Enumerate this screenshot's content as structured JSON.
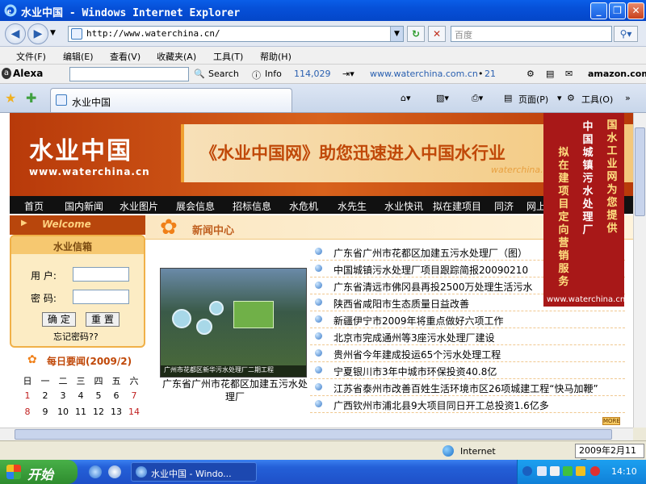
{
  "window": {
    "title": "水业中国 - Windows Internet Explorer"
  },
  "address": {
    "url": "http://www.waterchina.cn/",
    "search_placeholder": "百度"
  },
  "menu": [
    "文件(F)",
    "编辑(E)",
    "查看(V)",
    "收藏夹(A)",
    "工具(T)",
    "帮助(H)"
  ],
  "alexa": {
    "logo": "Alexa",
    "search": "Search",
    "info": "Info",
    "rank": "114,029",
    "site": "www.waterchina.com.cn",
    "count": "21",
    "amazon": "amazon.com"
  },
  "tab": {
    "label": "水业中国"
  },
  "toolbar": {
    "page": "页面(P)",
    "tools": "工具(O)"
  },
  "site": {
    "logo_big": "水业中国",
    "logo_url": "www.waterchina.cn",
    "slogan": "《水业中国网》助您迅速进入中国水行业",
    "slogan_url": "waterchina.c",
    "nav": [
      "首页",
      "国内新闻",
      "水业图片",
      "展会信息",
      "招标信息",
      "水危机",
      "水先生",
      "水业快讯",
      "拟在建项目",
      "同济",
      "网上"
    ],
    "welcome": "Welcome",
    "news_center": "新闻中心",
    "mailbox": {
      "title": "水业信箱",
      "user_label": "用 户:",
      "pass_label": "密 码:",
      "ok": "确 定",
      "reset": "重 置",
      "forgot": "忘记密码??"
    },
    "daily": "每日要闻(2009/2)",
    "calendar": {
      "weekdays": [
        "日",
        "一",
        "二",
        "三",
        "四",
        "五",
        "六"
      ],
      "rows": [
        [
          "1",
          "2",
          "3",
          "4",
          "5",
          "6",
          "7"
        ],
        [
          "8",
          "9",
          "10",
          "11",
          "12",
          "13",
          "14"
        ]
      ]
    },
    "photo_caption": "广东省广州市花都区加建五污水处理厂",
    "photo_overlay": "广州市花都区新华污水处理厂二期工程",
    "news": [
      "广东省广州市花都区加建五污水处理厂（图）",
      "中国城镇污水处理厂项目跟踪简报20090210",
      "广东省清远市佛冈县再投2500万处理生活污水",
      "陕西省咸阳市生态质量日益改善",
      "新疆伊宁市2009年将重点做好六项工作",
      "北京市完成通州等3座污水处理厂建设",
      "贵州省今年建成投运65个污水处理工程",
      "宁夏银川市3年中城市环保投资40.8亿",
      "江苏省泰州市改善百姓生活环境市区26项城建工程“快马加鞭”",
      "广西钦州市浦北县9大项目同日开工总投资1.6亿多"
    ],
    "more": "MORE",
    "ad": {
      "col1": "国水工业网为您提供",
      "col2": "中国城镇污水处理厂",
      "col3": "拟在建项目定向营销服务",
      "url": "www.waterchina.cn"
    }
  },
  "status": {
    "zone": "Internet",
    "date": "2009年2月11日"
  },
  "taskbar": {
    "start": "开始",
    "item": "水业中国 - Windo...",
    "time": "14:10"
  }
}
